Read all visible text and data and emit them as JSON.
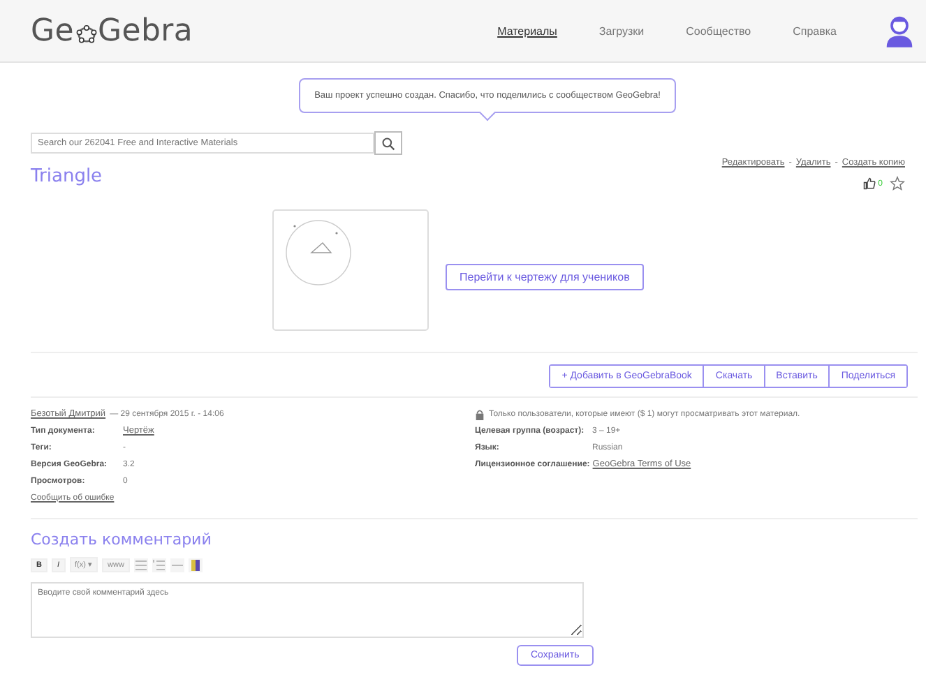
{
  "header": {
    "logo_left": "Ge",
    "logo_right": "Gebra",
    "nav": [
      {
        "label": "Материалы",
        "selected": true
      },
      {
        "label": "Загрузки",
        "selected": false
      },
      {
        "label": "Сообщество",
        "selected": false
      },
      {
        "label": "Справка",
        "selected": false
      }
    ]
  },
  "toast": "Ваш проект успешно создан. Спасибо, что поделились с сообществом GeoGebra!",
  "search": {
    "placeholder": "Search our 262041 Free and Interactive Materials"
  },
  "material": {
    "title": "Triangle",
    "actions": [
      "Редактировать",
      "Удалить",
      "Создать копию"
    ],
    "separator": "-",
    "likes": "0",
    "open_button": "Перейти к чертежу для учеников"
  },
  "buttons": [
    "+ Добавить в GeoGebraBook",
    "Скачать",
    "Вставить",
    "Поделиться"
  ],
  "meta": {
    "author": "Безотый Дмитрий",
    "date": "— 29 сентября 2015 г. - 14:06",
    "left": [
      {
        "label": "Тип документа:",
        "value": "Чертёж",
        "link": true
      },
      {
        "label": "Теги:",
        "value": "-",
        "link": false
      },
      {
        "label": "Версия GeoGebra:",
        "value": "3.2",
        "link": false
      },
      {
        "label": "Просмотров:",
        "value": "0",
        "link": false
      }
    ],
    "report": "Сообщить об ошибке",
    "access": "Только пользователи, которые имеют ($ 1) могут просматривать этот материал.",
    "right": [
      {
        "label": "Целевая группа (возраст):",
        "value": "3 – 19+",
        "link": false
      },
      {
        "label": "Язык:",
        "value": "Russian",
        "link": false
      },
      {
        "label": "Лицензионное соглашение:",
        "value": "GeoGebra Terms of Use",
        "link": true
      }
    ]
  },
  "comment": {
    "title": "Создать комментарий",
    "toolbar": [
      {
        "kind": "text",
        "label": "B"
      },
      {
        "kind": "text",
        "label": "I"
      },
      {
        "kind": "text",
        "label": "f(x) ▾"
      },
      {
        "kind": "text",
        "label": "www"
      },
      {
        "kind": "list"
      },
      {
        "kind": "numlist"
      },
      {
        "kind": "rule"
      },
      {
        "kind": "color"
      }
    ],
    "placeholder": "Вводите свой комментарий здесь",
    "save": "Сохранить"
  }
}
